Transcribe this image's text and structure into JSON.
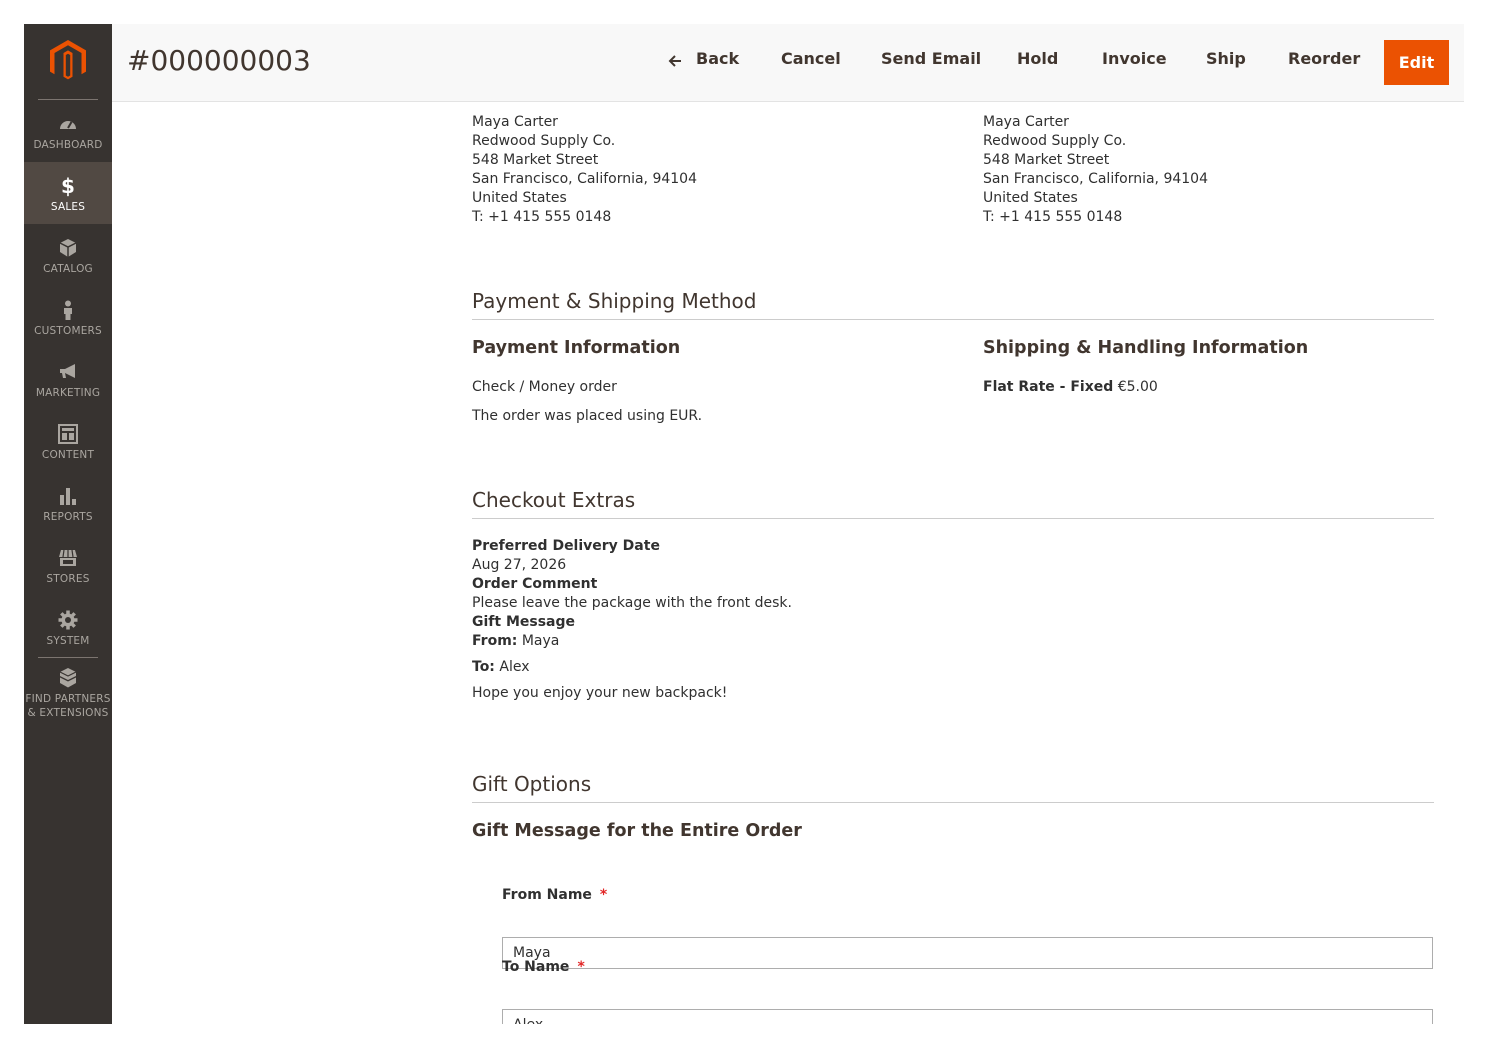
{
  "sidebar": {
    "items": [
      {
        "label": "DASHBOARD",
        "icon": "dashboard-icon"
      },
      {
        "label": "SALES",
        "icon": "dollar-icon",
        "active": true
      },
      {
        "label": "CATALOG",
        "icon": "box-icon"
      },
      {
        "label": "CUSTOMERS",
        "icon": "person-icon"
      },
      {
        "label": "MARKETING",
        "icon": "megaphone-icon"
      },
      {
        "label": "CONTENT",
        "icon": "layout-icon"
      },
      {
        "label": "REPORTS",
        "icon": "bar-chart-icon"
      },
      {
        "label": "STORES",
        "icon": "storefront-icon"
      },
      {
        "label": "SYSTEM",
        "icon": "gear-icon"
      }
    ],
    "partners": {
      "line1": "FIND PARTNERS",
      "line2": "& EXTENSIONS",
      "icon": "cubes-icon"
    }
  },
  "header": {
    "title": "#000000003",
    "buttons": {
      "back": "Back",
      "cancel": "Cancel",
      "send_email": "Send Email",
      "hold": "Hold",
      "invoice": "Invoice",
      "ship": "Ship",
      "reorder": "Reorder",
      "edit": "Edit"
    }
  },
  "billing_address": {
    "lines": [
      "Maya Carter",
      "Redwood Supply Co.",
      "548 Market Street",
      "San Francisco, California, 94104",
      "United States",
      "T: +1 415 555 0148"
    ]
  },
  "shipping_address": {
    "lines": [
      "Maya Carter",
      "Redwood Supply Co.",
      "548 Market Street",
      "San Francisco, California, 94104",
      "United States",
      "T: +1 415 555 0148"
    ]
  },
  "payment_shipping": {
    "title": "Payment & Shipping Method",
    "payment_title": "Payment Information",
    "payment_method": "Check / Money order",
    "currency_note": "The order was placed using EUR.",
    "shipping_title": "Shipping & Handling Information",
    "shipping_method": "Flat Rate - Fixed",
    "shipping_price": "€5.00"
  },
  "checkout_extras": {
    "title": "Checkout Extras",
    "delivery_label": "Preferred Delivery Date",
    "delivery_value": "Aug 27, 2026",
    "comment_label": "Order Comment",
    "comment_value": "Please leave the package with the front desk.",
    "gift_label": "Gift Message",
    "from_label": "From:",
    "from_value": "Maya",
    "to_label": "To:",
    "to_value": "Alex",
    "message": "Hope you enjoy your new backpack!"
  },
  "gift_options": {
    "title": "Gift Options",
    "subtitle": "Gift Message for the Entire Order",
    "from_name_label": "From Name",
    "from_name_value": "Maya",
    "to_name_label": "To Name",
    "to_name_value": "Alex",
    "required_mark": "*"
  },
  "colors": {
    "sidebar_bg": "#373330",
    "sidebar_active": "#514943",
    "accent": "#eb5202",
    "required": "#e22626"
  }
}
